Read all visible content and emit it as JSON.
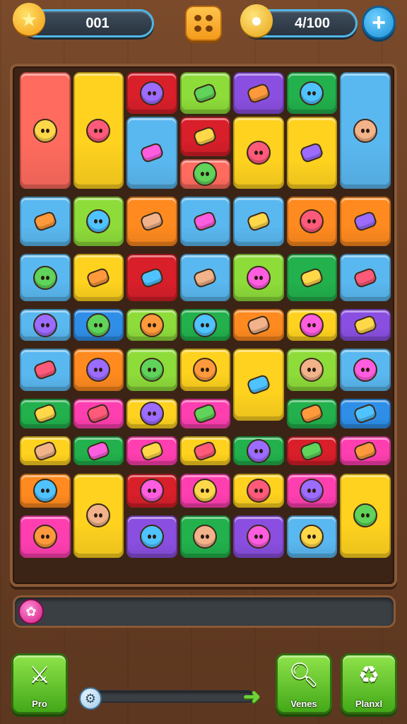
{
  "hud": {
    "level_value": "001",
    "coins_value": "4/100",
    "colors": {
      "accent": "#4fb6e8",
      "menu": "#f39a1b",
      "plus": "#1a8fd8"
    }
  },
  "icons": {
    "star": "star-icon",
    "coin": "coin-icon",
    "menu": "grid-menu-icon",
    "plus": "plus-icon",
    "gem": "gem-icon",
    "sword": "sword-icon",
    "magnifier": "magnifier-icon",
    "shuffle": "shuffle-icon"
  },
  "progress": {
    "fraction": 0.0
  },
  "slider": {
    "fraction": 0.0
  },
  "buttons": {
    "pro_label": "Pro",
    "venes_label": "Venes",
    "planxl_label": "Planxl"
  },
  "tile_colors": [
    "#ff6b5e",
    "#ffd21f",
    "#d81f2a",
    "#8edc3a",
    "#8a4fe0",
    "#22b14c",
    "#5ab8f0",
    "#ff8a1f",
    "#ff3fb0",
    "#2f8fe8"
  ]
}
